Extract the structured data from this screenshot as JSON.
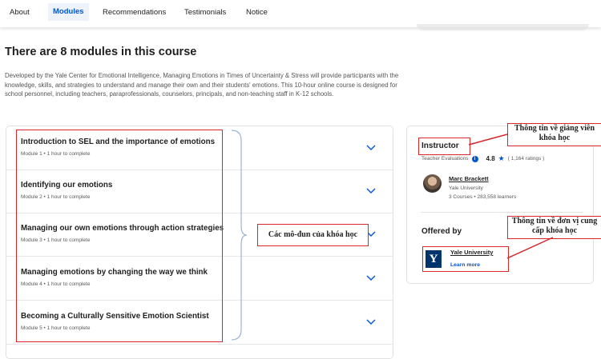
{
  "tabs": [
    {
      "label": "About",
      "active": false
    },
    {
      "label": "Modules",
      "active": true
    },
    {
      "label": "Recommendations",
      "active": false
    },
    {
      "label": "Testimonials",
      "active": false
    },
    {
      "label": "Notice",
      "active": false
    }
  ],
  "main": {
    "title": "There are 8 modules in this course",
    "description": "Developed by the Yale Center for Emotional Intelligence, Managing Emotions in Times of Uncertainty & Stress will provide participants with the knowledge, skills, and strategies to understand and manage their own and their students' emotions. This 10-hour online course is designed for school personnel, including teachers, paraprofessionals, counselors, principals, and non-teaching staff in K-12 schools."
  },
  "modules": [
    {
      "title": "Introduction to SEL and the importance of emotions",
      "meta": "Module 1  •  1 hour to complete"
    },
    {
      "title": "Identifying our emotions",
      "meta": "Module 2  •  1 hour to complete"
    },
    {
      "title": "Managing our own emotions through action strategies",
      "meta": "Module 3  •  1 hour to complete"
    },
    {
      "title": "Managing emotions by changing the way we think",
      "meta": "Module 4  •  1 hour to complete"
    },
    {
      "title": "Becoming a Culturally Sensitive Emotion Scientist",
      "meta": "Module 5  •  1 hour to complete"
    }
  ],
  "instructor": {
    "heading": "Instructor",
    "evaluations_label": "Teacher Evaluations",
    "rating": "4.8",
    "rating_count": "( 1,164 ratings )",
    "name": "Marc Brackett",
    "university": "Yale University",
    "stats": "3 Courses  •  283,558 learners"
  },
  "offered_by": {
    "heading": "Offered by",
    "logo_letter": "Y",
    "org_name": "Yale University",
    "learn_more": "Learn more"
  },
  "annotations": {
    "modules_label": "Các mô-đun của khóa học",
    "instructor_info": "Thông tin về giảng viên khóa học",
    "org_info": "Thông tin về đơn vị cung cấp khóa học"
  },
  "colors": {
    "accent": "#0056d2",
    "annotation_red": "#d9262b",
    "yale_blue": "#00356b"
  }
}
